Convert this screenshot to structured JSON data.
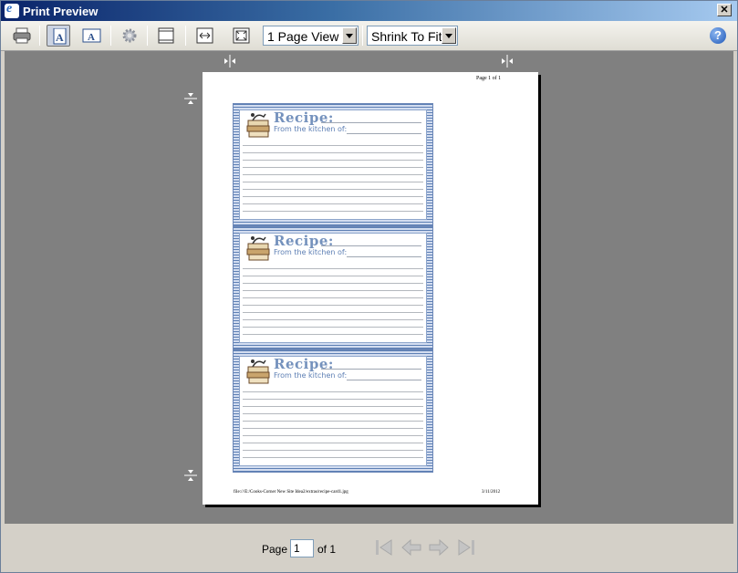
{
  "window": {
    "title": "Print Preview",
    "close_label": "✕"
  },
  "toolbar": {
    "buttons": [
      {
        "name": "print-button",
        "icon": "printer-icon"
      },
      {
        "name": "portrait-button",
        "icon": "portrait-icon",
        "pressed": true
      },
      {
        "name": "landscape-button",
        "icon": "landscape-icon"
      },
      {
        "name": "page-setup-button",
        "icon": "gear-icon"
      },
      {
        "name": "headers-footers-button",
        "icon": "header-footer-icon"
      },
      {
        "name": "full-width-button",
        "icon": "full-width-icon"
      },
      {
        "name": "full-page-button",
        "icon": "full-page-icon"
      }
    ],
    "view_select": "1 Page View",
    "scale_select": "Shrink To Fit",
    "help_label": "?"
  },
  "page": {
    "page_number_text": "Page 1 of 1",
    "footer_path": "file:///E:/Cooks-Corner New Site Idea2/extras/recipe-card1.jpg",
    "footer_date": "3/11/2012",
    "cards": [
      {
        "title": "Recipe:",
        "subtitle": "From the kitchen of:"
      },
      {
        "title": "Recipe:",
        "subtitle": "From the kitchen of:"
      },
      {
        "title": "Recipe:",
        "subtitle": "From the kitchen of:"
      }
    ]
  },
  "statusbar": {
    "page_label": "Page",
    "page_value": "1",
    "of_label": "of 1"
  },
  "colors": {
    "title_gradient_start": "#0a246a",
    "preview_background": "#808080",
    "card_accent": "#7592bd"
  }
}
